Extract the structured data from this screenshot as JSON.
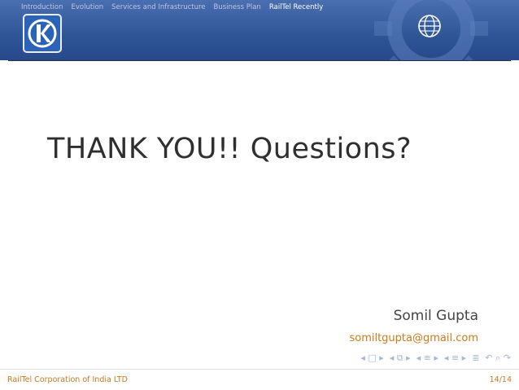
{
  "nav": {
    "items": [
      "Introduction",
      "Evolution",
      "Services and Infrastructure",
      "Business Plan",
      "RailTel Recently"
    ],
    "active_index": 4
  },
  "slide": {
    "title": "THANK YOU!! Questions?",
    "author": "Somil Gupta",
    "email": "somiltgupta@gmail.com"
  },
  "footer": {
    "org": "RailTel Corporation of India LTD",
    "page": "14/14"
  },
  "colors": {
    "header_blue": "#2e5596",
    "accent_orange": "#c77b1a"
  },
  "icons": {
    "logo": "kde-logo-icon",
    "globe": "globe-icon",
    "nav_controls": "beamer-navigation-icons"
  }
}
